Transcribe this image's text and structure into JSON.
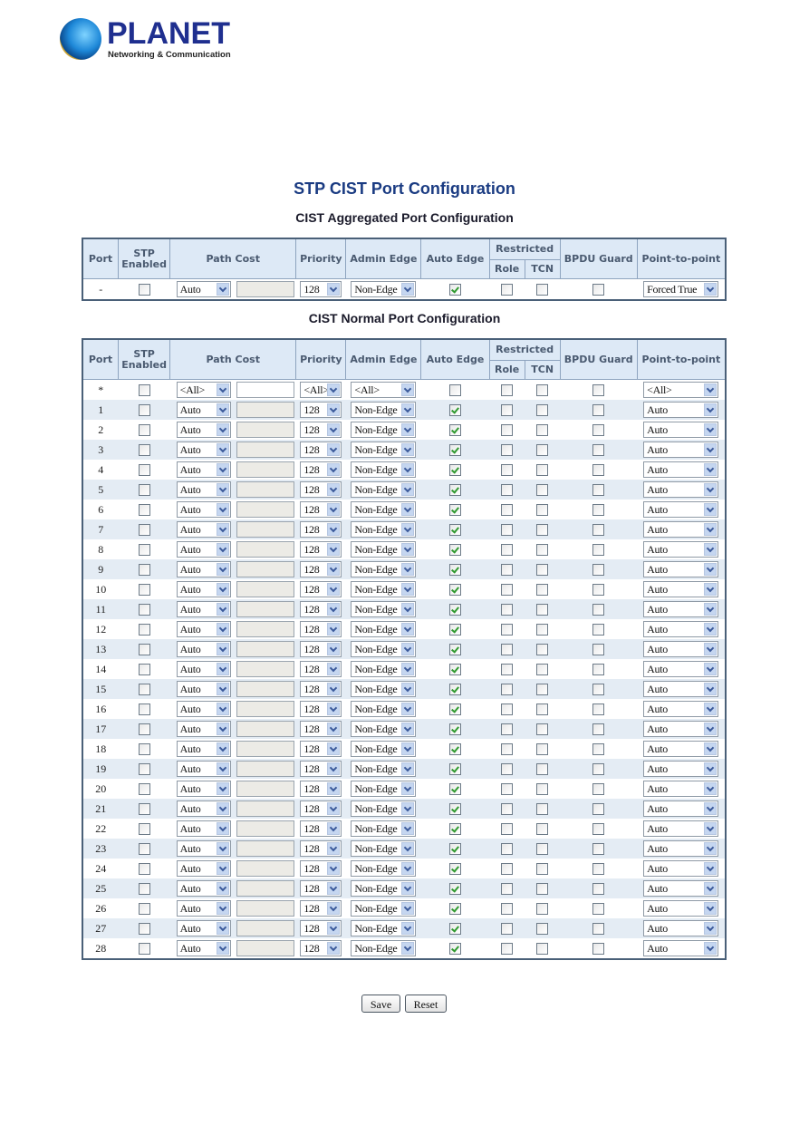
{
  "logo": {
    "brand": "PLANET",
    "tagline": "Networking & Communication"
  },
  "page_title": "STP CIST Port Configuration",
  "aggregated": {
    "title": "CIST Aggregated Port Configuration",
    "row": {
      "port": "-",
      "stp_enabled": false,
      "path_cost_mode": "Auto",
      "path_cost_value": "",
      "priority": "128",
      "admin_edge": "Non-Edge",
      "auto_edge": true,
      "restricted_role": false,
      "restricted_tcn": false,
      "bpdu_guard": false,
      "point_to_point": "Forced True"
    }
  },
  "normal": {
    "title": "CIST Normal Port Configuration",
    "all_row": {
      "port": "*",
      "stp_enabled": false,
      "path_cost_mode": "<All>",
      "path_cost_value": "",
      "priority": "<All>",
      "admin_edge": "<All>",
      "auto_edge": false,
      "restricted_role": false,
      "restricted_tcn": false,
      "bpdu_guard": false,
      "point_to_point": "<All>"
    },
    "rows": [
      {
        "port": "1"
      },
      {
        "port": "2"
      },
      {
        "port": "3"
      },
      {
        "port": "4"
      },
      {
        "port": "5"
      },
      {
        "port": "6"
      },
      {
        "port": "7"
      },
      {
        "port": "8"
      },
      {
        "port": "9"
      },
      {
        "port": "10"
      },
      {
        "port": "11"
      },
      {
        "port": "12"
      },
      {
        "port": "13"
      },
      {
        "port": "14"
      },
      {
        "port": "15"
      },
      {
        "port": "16"
      },
      {
        "port": "17"
      },
      {
        "port": "18"
      },
      {
        "port": "19"
      },
      {
        "port": "20"
      },
      {
        "port": "21"
      },
      {
        "port": "22"
      },
      {
        "port": "23"
      },
      {
        "port": "24"
      },
      {
        "port": "25"
      },
      {
        "port": "26"
      },
      {
        "port": "27"
      },
      {
        "port": "28"
      }
    ],
    "row_defaults": {
      "stp_enabled": false,
      "path_cost_mode": "Auto",
      "path_cost_value": "",
      "priority": "128",
      "admin_edge": "Non-Edge",
      "auto_edge": true,
      "restricted_role": false,
      "restricted_tcn": false,
      "bpdu_guard": false,
      "point_to_point": "Auto"
    }
  },
  "headers": {
    "port": "Port",
    "stp_enabled": "STP Enabled",
    "path_cost": "Path Cost",
    "priority": "Priority",
    "admin_edge": "Admin Edge",
    "auto_edge": "Auto Edge",
    "restricted": "Restricted",
    "role": "Role",
    "tcn": "TCN",
    "bpdu_guard": "BPDU Guard",
    "point_to_point": "Point-to-point"
  },
  "buttons": {
    "save": "Save",
    "reset": "Reset"
  }
}
